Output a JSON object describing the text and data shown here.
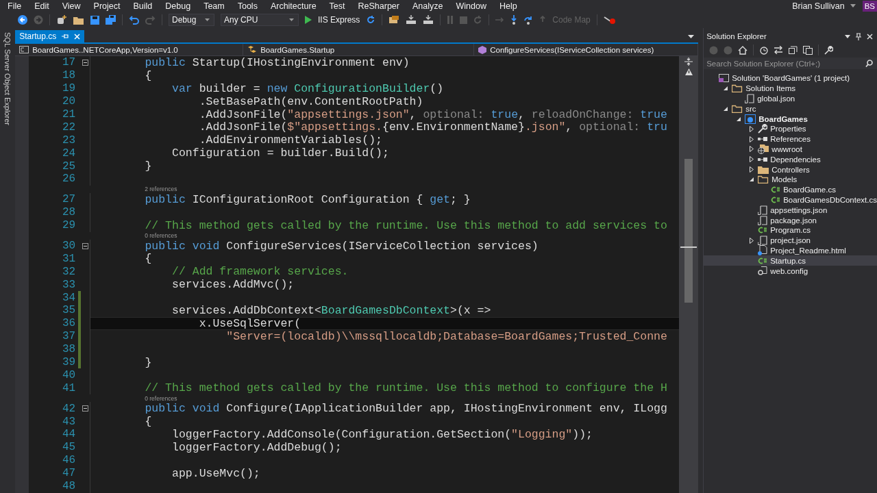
{
  "menu": [
    "File",
    "Edit",
    "View",
    "Project",
    "Build",
    "Debug",
    "Team",
    "Tools",
    "Architecture",
    "Test",
    "ReSharper",
    "Analyze",
    "Window",
    "Help"
  ],
  "user": {
    "name": "Brian Sullivan",
    "initials": "BS"
  },
  "toolbar": {
    "configuration": "Debug",
    "platform": "Any CPU",
    "run_target": "IIS Express",
    "code_map": {
      "label": "Code Map",
      "disabled": true
    }
  },
  "side_tab": "SQL Server Object Explorer",
  "document_tabs": [
    {
      "label": "Startup.cs",
      "selected": true
    }
  ],
  "navigation_bar": [
    "BoardGames..NETCoreApp,Version=v1.0",
    "BoardGames.Startup",
    "ConfigureServices(IServiceCollection services)"
  ],
  "editor": {
    "lines": [
      {
        "n": "17",
        "collapsed": false,
        "changed": false,
        "current": false,
        "tokens": [
          {
            "kind": "keyword",
            "t": "        public"
          },
          {
            "kind": "plain",
            "t": " Startup(IHostingEnvironment env)"
          }
        ]
      },
      {
        "n": "18",
        "changed": false,
        "current": false,
        "tokens": [
          {
            "kind": "plain",
            "t": "        {"
          }
        ]
      },
      {
        "n": "19",
        "changed": false,
        "current": false,
        "tokens": [
          {
            "kind": "keyword",
            "t": "            var"
          },
          {
            "kind": "plain",
            "t": " builder = "
          },
          {
            "kind": "keyword",
            "t": "new"
          },
          {
            "kind": "type",
            "t": " ConfigurationBuilder"
          },
          {
            "kind": "plain",
            "t": "()"
          }
        ]
      },
      {
        "n": "20",
        "changed": false,
        "current": false,
        "tokens": [
          {
            "kind": "plain",
            "t": "                .SetBasePath(env.ContentRootPath)"
          }
        ]
      },
      {
        "n": "21",
        "changed": false,
        "current": false,
        "tokens": [
          {
            "kind": "plain",
            "t": "                .AddJsonFile("
          },
          {
            "kind": "string",
            "t": "\"appsettings.json\""
          },
          {
            "kind": "plain",
            "t": ", "
          },
          {
            "kind": "hint",
            "t": "optional: "
          },
          {
            "kind": "keyword",
            "t": "true"
          },
          {
            "kind": "plain",
            "t": ", "
          },
          {
            "kind": "hint",
            "t": "reloadOnChange: "
          },
          {
            "kind": "keyword",
            "t": "true"
          }
        ]
      },
      {
        "n": "22",
        "changed": false,
        "current": false,
        "tokens": [
          {
            "kind": "plain",
            "t": "                .AddJsonFile("
          },
          {
            "kind": "string",
            "t": "$\"appsettings."
          },
          {
            "kind": "plain",
            "t": "{env.EnvironmentName}"
          },
          {
            "kind": "string",
            "t": ".json\""
          },
          {
            "kind": "plain",
            "t": ", "
          },
          {
            "kind": "hint",
            "t": "optional: "
          },
          {
            "kind": "keyword",
            "t": "tru"
          }
        ]
      },
      {
        "n": "23",
        "changed": false,
        "current": false,
        "tokens": [
          {
            "kind": "plain",
            "t": "                .AddEnvironmentVariables();"
          }
        ]
      },
      {
        "n": "24",
        "changed": false,
        "current": false,
        "tokens": [
          {
            "kind": "plain",
            "t": "            Configuration = builder.Build();"
          }
        ]
      },
      {
        "n": "25",
        "changed": false,
        "current": false,
        "tokens": [
          {
            "kind": "plain",
            "t": "        }"
          }
        ]
      },
      {
        "n": "26",
        "changed": false,
        "current": false
      },
      {
        "n": "27",
        "lens": "2 references",
        "changed": false,
        "current": false,
        "tokens": [
          {
            "kind": "keyword",
            "t": "        public"
          },
          {
            "kind": "plain",
            "t": " IConfigurationRoot Configuration { "
          },
          {
            "kind": "keyword",
            "t": "get"
          },
          {
            "kind": "plain",
            "t": "; }"
          }
        ]
      },
      {
        "n": "28",
        "changed": false,
        "current": false
      },
      {
        "n": "29",
        "changed": false,
        "current": false,
        "tokens": [
          {
            "kind": "comment",
            "t": "        // This method gets called by the runtime. Use this method to add services to"
          }
        ]
      },
      {
        "n": "30",
        "lens": "0 references",
        "collapsed": false,
        "changed": false,
        "current": false,
        "tokens": [
          {
            "kind": "keyword",
            "t": "        public void"
          },
          {
            "kind": "plain",
            "t": " ConfigureServices(IServiceCollection services)"
          }
        ]
      },
      {
        "n": "31",
        "changed": false,
        "current": false,
        "tokens": [
          {
            "kind": "plain",
            "t": "        {"
          }
        ]
      },
      {
        "n": "32",
        "changed": false,
        "current": false,
        "tokens": [
          {
            "kind": "comment",
            "t": "            // Add framework services."
          }
        ]
      },
      {
        "n": "33",
        "changed": false,
        "current": false,
        "tokens": [
          {
            "kind": "plain",
            "t": "            services.AddMvc();"
          }
        ]
      },
      {
        "n": "34",
        "changed": true,
        "current": false
      },
      {
        "n": "35",
        "changed": true,
        "current": false,
        "tokens": [
          {
            "kind": "plain",
            "t": "            services.AddDbContext<"
          },
          {
            "kind": "type",
            "t": "BoardGamesDbContext"
          },
          {
            "kind": "plain",
            "t": ">(x =>"
          }
        ]
      },
      {
        "n": "36",
        "changed": true,
        "current": true,
        "tokens": [
          {
            "kind": "plain",
            "t": "                x.UseSqlServer("
          }
        ]
      },
      {
        "n": "37",
        "changed": true,
        "current": false,
        "tokens": [
          {
            "kind": "string",
            "t": "                    \"Server=(localdb)\\\\mssqllocaldb;Database=BoardGames;Trusted_Conne"
          }
        ]
      },
      {
        "n": "38",
        "changed": true,
        "current": false
      },
      {
        "n": "39",
        "changed": true,
        "current": false,
        "tokens": [
          {
            "kind": "plain",
            "t": "        }"
          }
        ]
      },
      {
        "n": "40",
        "changed": false,
        "current": false
      },
      {
        "n": "41",
        "changed": false,
        "current": false,
        "tokens": [
          {
            "kind": "comment",
            "t": "        // This method gets called by the runtime. Use this method to configure the H"
          }
        ]
      },
      {
        "n": "42",
        "lens": "0 references",
        "collapsed": false,
        "changed": false,
        "current": false,
        "tokens": [
          {
            "kind": "keyword",
            "t": "        public void"
          },
          {
            "kind": "plain",
            "t": " Configure(IApplicationBuilder app, IHostingEnvironment env, ILogg"
          }
        ]
      },
      {
        "n": "43",
        "changed": false,
        "current": false,
        "tokens": [
          {
            "kind": "plain",
            "t": "        {"
          }
        ]
      },
      {
        "n": "44",
        "changed": false,
        "current": false,
        "tokens": [
          {
            "kind": "plain",
            "t": "            loggerFactory.AddConsole(Configuration.GetSection("
          },
          {
            "kind": "string",
            "t": "\"Logging\""
          },
          {
            "kind": "plain",
            "t": "));"
          }
        ]
      },
      {
        "n": "45",
        "changed": false,
        "current": false,
        "tokens": [
          {
            "kind": "plain",
            "t": "            loggerFactory.AddDebug();"
          }
        ]
      },
      {
        "n": "46",
        "changed": false,
        "current": false
      },
      {
        "n": "47",
        "changed": false,
        "current": false,
        "tokens": [
          {
            "kind": "plain",
            "t": "            app.UseMvc();"
          }
        ]
      },
      {
        "n": "48",
        "changed": false,
        "current": false
      }
    ]
  },
  "solution_explorer": {
    "title": "Solution Explorer",
    "search": {
      "placeholder": "Search Solution Explorer (Ctrl+;)"
    },
    "tree": [
      {
        "label": "Solution 'BoardGames' (1 project)",
        "kind": "solution",
        "selected": false,
        "children": [
          {
            "label": "Solution Items",
            "kind": "folder",
            "expanded": true,
            "selected": false,
            "children": [
              {
                "label": "global.json",
                "kind": "json",
                "selected": false
              }
            ]
          },
          {
            "label": "src",
            "kind": "folder",
            "expanded": true,
            "selected": false,
            "children": [
              {
                "label": "BoardGames",
                "kind": "project",
                "expanded": true,
                "selected": false,
                "children": [
                  {
                    "label": "Properties",
                    "kind": "properties",
                    "expanded": false,
                    "selected": false
                  },
                  {
                    "label": "References",
                    "kind": "references",
                    "expanded": false,
                    "selected": false
                  },
                  {
                    "label": "wwwroot",
                    "kind": "web",
                    "expanded": false,
                    "selected": false
                  },
                  {
                    "label": "Dependencies",
                    "kind": "dependencies",
                    "expanded": false,
                    "selected": false
                  },
                  {
                    "label": "Controllers",
                    "kind": "folder",
                    "expanded": false,
                    "selected": false
                  },
                  {
                    "label": "Models",
                    "kind": "folder",
                    "expanded": true,
                    "selected": false,
                    "children": [
                      {
                        "label": "BoardGame.cs",
                        "kind": "cs",
                        "selected": false
                      },
                      {
                        "label": "BoardGamesDbContext.cs",
                        "kind": "cs",
                        "selected": false
                      }
                    ]
                  },
                  {
                    "label": "appsettings.json",
                    "kind": "json",
                    "selected": false
                  },
                  {
                    "label": "package.json",
                    "kind": "json",
                    "selected": false
                  },
                  {
                    "label": "Program.cs",
                    "kind": "cs",
                    "selected": false
                  },
                  {
                    "label": "project.json",
                    "kind": "json",
                    "expanded": false,
                    "selected": false
                  },
                  {
                    "label": "Project_Readme.html",
                    "kind": "html",
                    "selected": false
                  },
                  {
                    "label": "Startup.cs",
                    "kind": "cs",
                    "selected": true
                  },
                  {
                    "label": "web.config",
                    "kind": "config",
                    "selected": false
                  }
                ]
              }
            ]
          }
        ]
      }
    ]
  }
}
